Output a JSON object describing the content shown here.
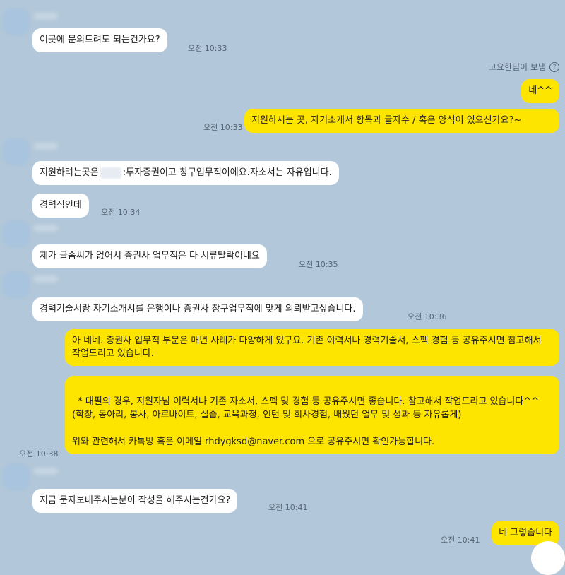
{
  "messages": {
    "m1": {
      "text": "이곳에 문의드려도 되는건가요?",
      "time": "오전 10:33"
    },
    "sender_note": "고요한님이 보냄",
    "m2": {
      "text": "네^^"
    },
    "m3": {
      "text": "지원하시는 곳, 자기소개서 항목과 글자수 / 혹은 양식이 있으신가요?~",
      "time": "오전 10:33"
    },
    "m4": {
      "before": "지원하려는곳은",
      "after": ":투자증권이고 창구업무직이에요.자소서는 자유입니다."
    },
    "m5": {
      "text": "경력직인데",
      "time": "오전 10:34"
    },
    "m6": {
      "text": "제가 글솜씨가 없어서 증권사 업무직은 다 서류탈락이네요",
      "time": "오전 10:35"
    },
    "m7": {
      "text": "경력기술서랑 자기소개서를 은행이나 증권사 창구업무직에 맞게 의뢰받고싶습니다.",
      "time": "오전 10:36"
    },
    "m8": {
      "text": "아 네네. 증권사 업무직 부문은 매년 사례가 다양하게 있구요. 기존 이력서나 경력기술서, 스펙 경험 등 공유주시면 참고해서 작업드리고 있습니다."
    },
    "m9": {
      "text": "* 대필의 경우, 지원자님 이력서나 기존 자소서, 스펙 및 경험 등 공유주시면 좋습니다. 참고해서 작업드리고 있습니다^^\n(학창, 동아리, 봉사, 아르바이트, 실습, 교육과정, 인턴 및 회사경험, 배웠던 업무 및 성과 등 자유롭게)\n\n위와 관련해서 카톡방 혹은 이메일 rhdygksd@naver.com 으로 공유주시면 확인가능합니다.",
      "time": "오전 10:38"
    },
    "m10": {
      "text": "지금 문자보내주시는분이 작성을 해주시는건가요?",
      "time": "오전 10:41"
    },
    "m11": {
      "text": "네 그렇습니다",
      "time": "오전 10:41"
    }
  },
  "icons": {
    "help": "question-circle-icon"
  },
  "colors": {
    "background": "#b2c7d9",
    "incoming": "#ffffff",
    "outgoing": "#fee500"
  }
}
